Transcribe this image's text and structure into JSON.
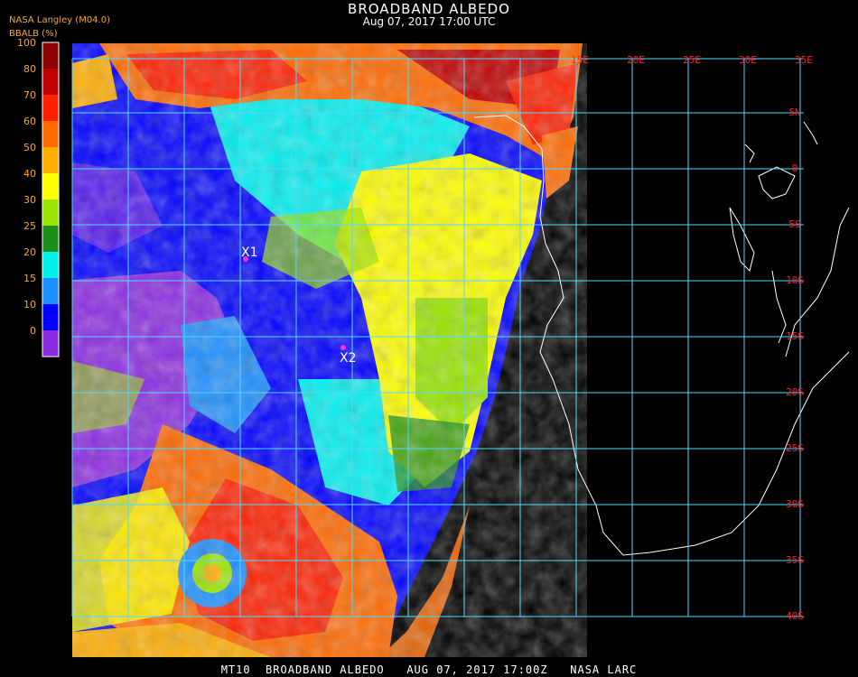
{
  "header": {
    "title": "BROADBAND ALBEDO",
    "subtitle": "Aug 07, 2017 17:00 UTC",
    "source": "NASA Langley (M04.0)",
    "param_label": "BBALB (%)"
  },
  "legend": {
    "ticks": [
      "100",
      "80",
      "70",
      "60",
      "50",
      "40",
      "30",
      "25",
      "20",
      "15",
      "10",
      "0"
    ],
    "colors": [
      "#8b0000",
      "#c00000",
      "#ff2000",
      "#ff6a00",
      "#ffae00",
      "#ffff00",
      "#9ae600",
      "#1a8f1a",
      "#00f0f0",
      "#1e8fff",
      "#0000ff",
      "#8a2be2"
    ]
  },
  "map": {
    "lon_labels": [
      "15E",
      "20E",
      "25E",
      "30E",
      "35E"
    ],
    "lat_labels": [
      "5N",
      "0",
      "5S",
      "10S",
      "15S",
      "20S",
      "25S",
      "30S",
      "35S",
      "40S"
    ],
    "markers": [
      {
        "label": "X1"
      },
      {
        "label": "X2"
      }
    ],
    "grid_color": "#4fd8ff",
    "label_color": "#ff2020"
  },
  "footer": "MT10  BROADBAND ALBEDO   AUG 07, 2017 17:00Z   NASA LARC"
}
